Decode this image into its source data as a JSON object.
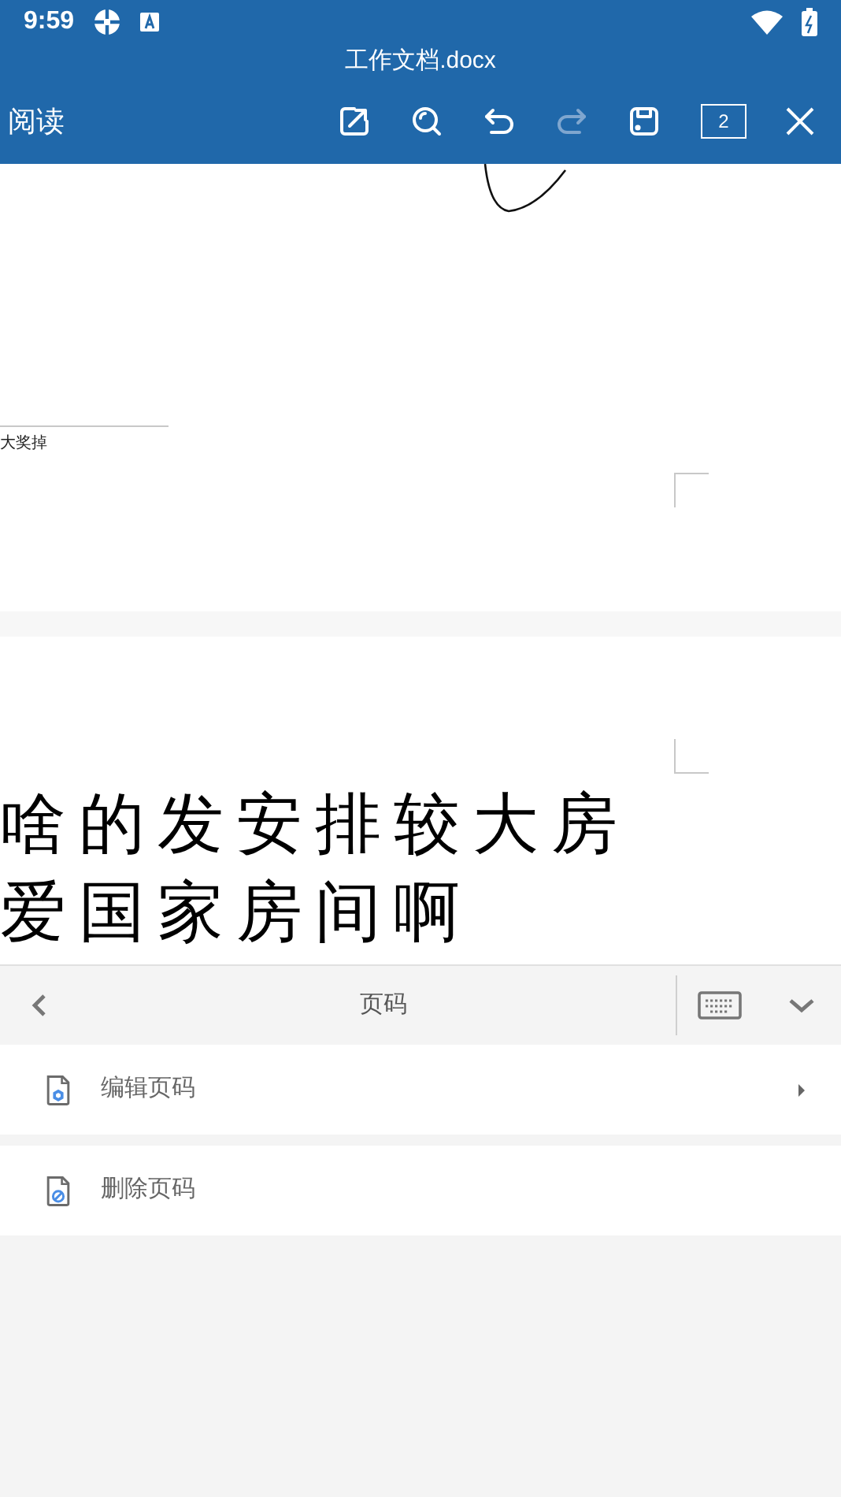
{
  "status_bar": {
    "time": "9:59"
  },
  "title_bar": {
    "title": "工作文档.docx"
  },
  "toolbar": {
    "mode": "阅读",
    "page_count": "2",
    "actions": [
      {
        "kind": "edit",
        "disabled": false
      },
      {
        "kind": "search",
        "disabled": false
      },
      {
        "kind": "undo",
        "disabled": false
      },
      {
        "kind": "redo",
        "disabled": true
      },
      {
        "kind": "save",
        "disabled": false
      }
    ]
  },
  "document": {
    "caption": "大奖掉",
    "lines": [
      "啥的发安排较大房",
      "爱国家房间啊"
    ]
  },
  "panel": {
    "title": "页码",
    "items": [
      {
        "kind": "edit",
        "label": "编辑页码",
        "has_submenu": true
      },
      {
        "kind": "delete",
        "label": "删除页码",
        "has_submenu": false
      }
    ]
  }
}
